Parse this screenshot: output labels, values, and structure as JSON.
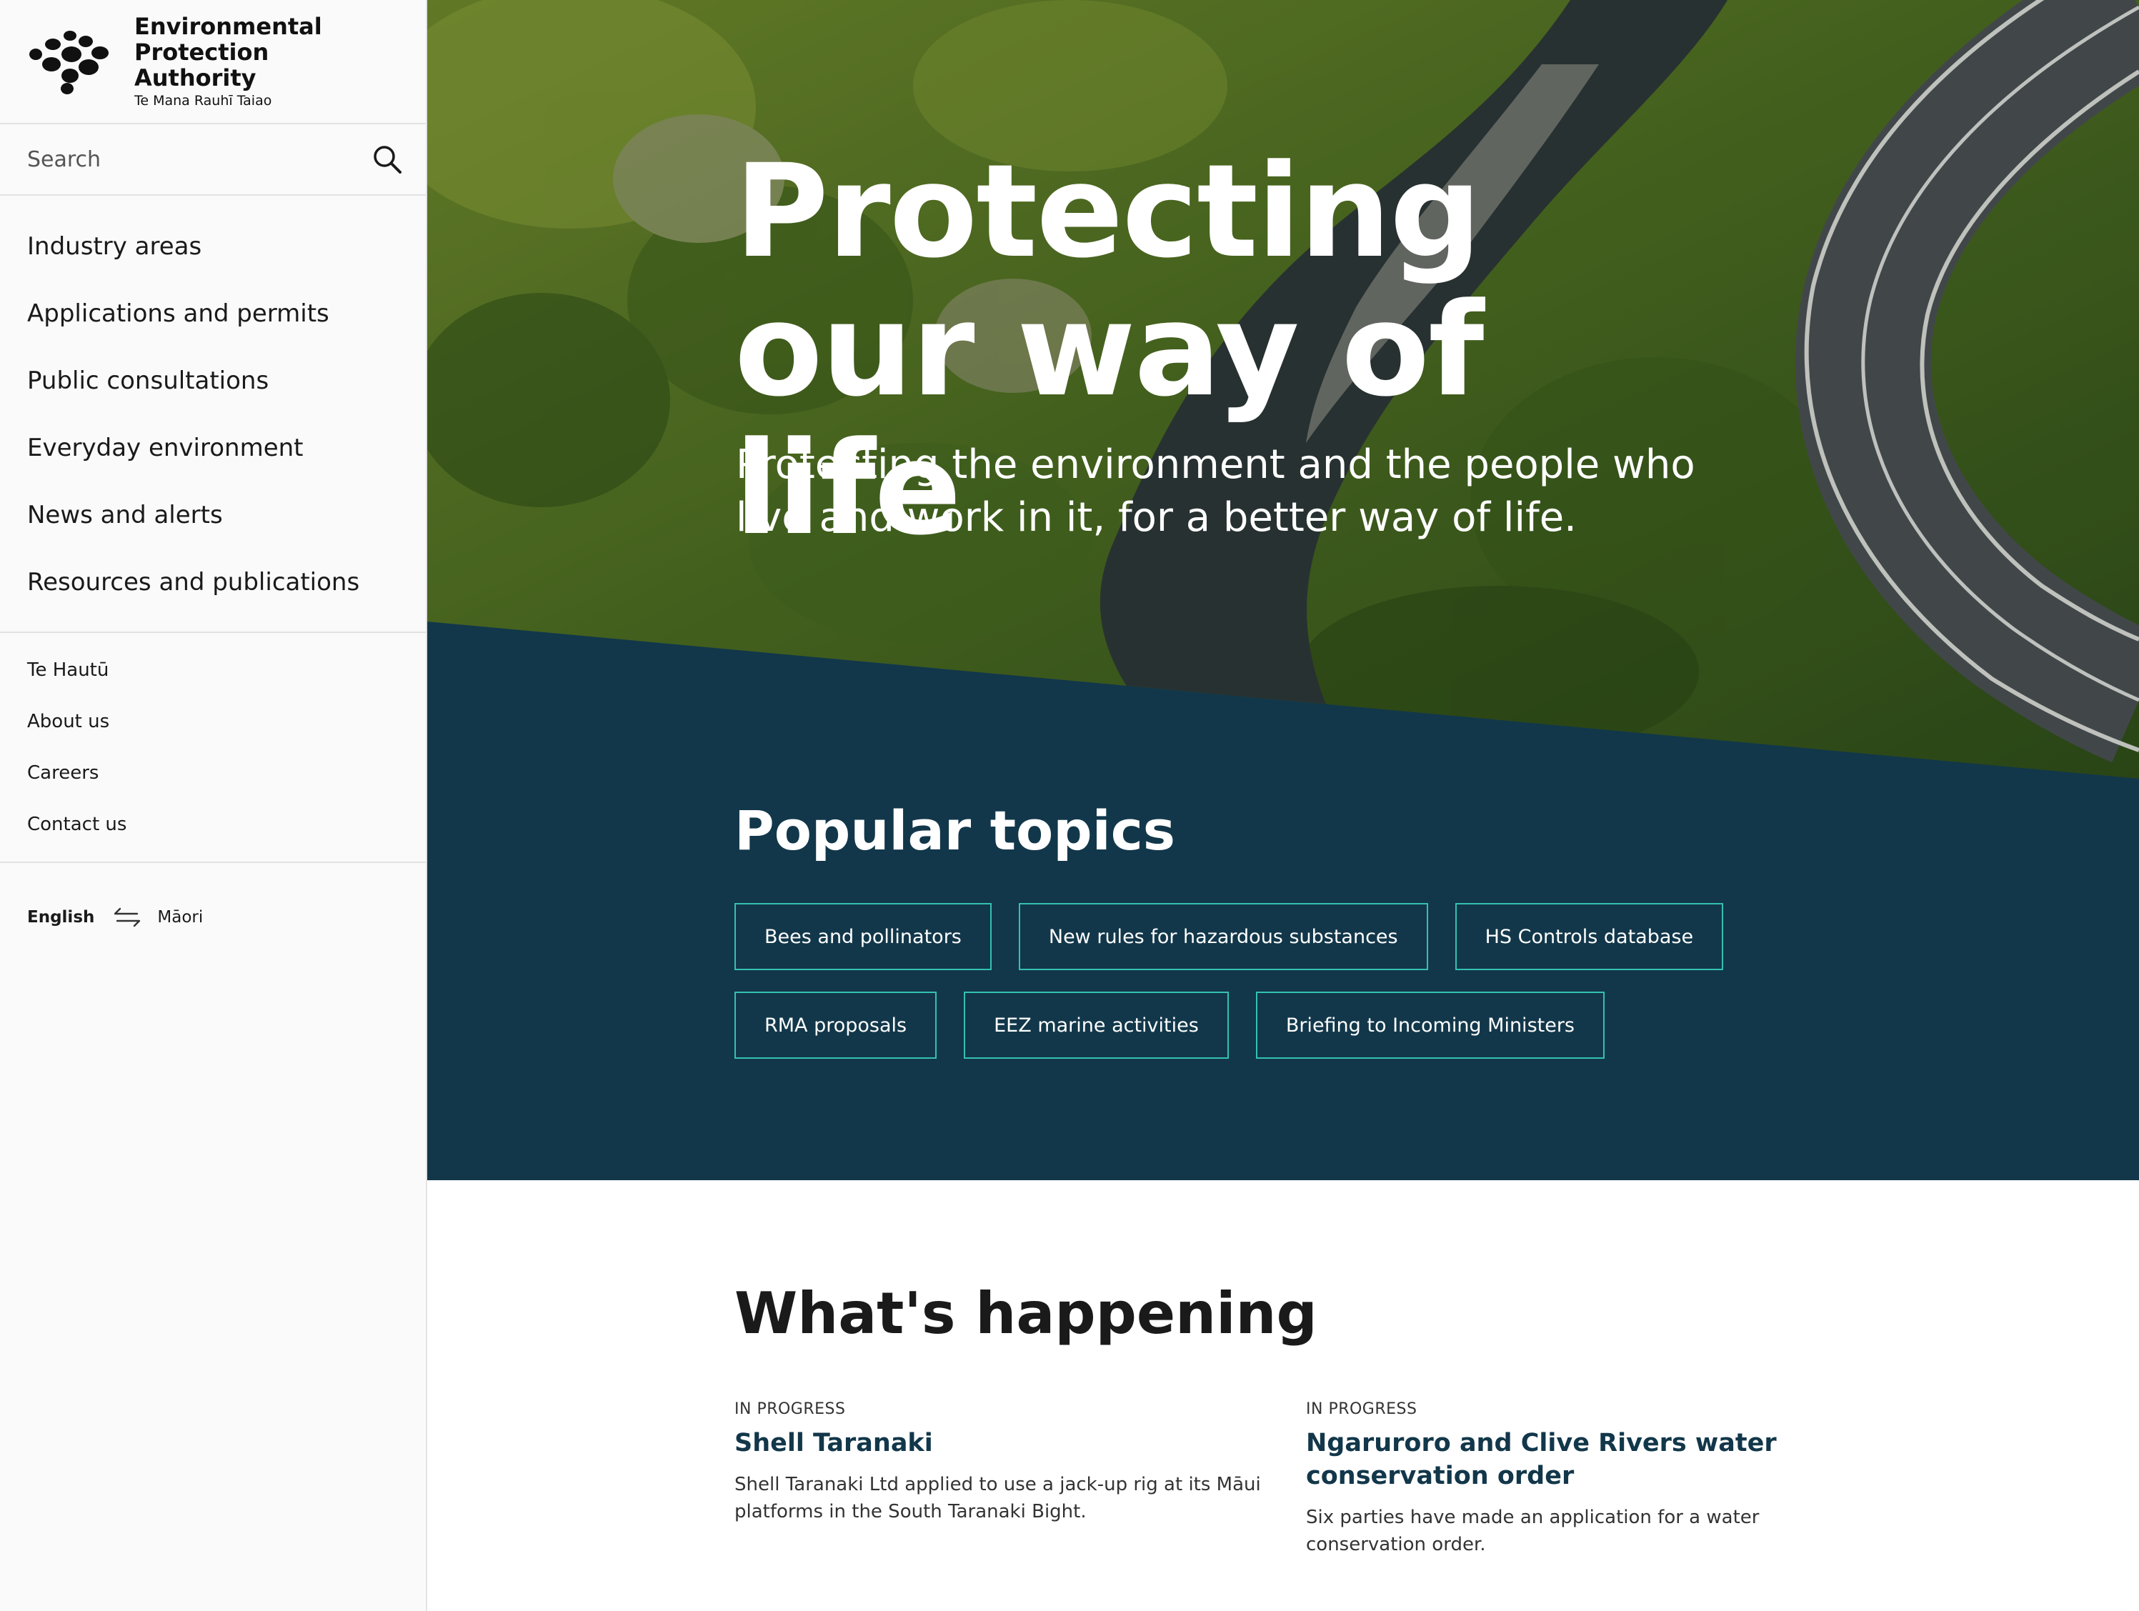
{
  "brand": {
    "name": "Environmental Protection Authority",
    "sub": "Te Mana Rauhī Taiao"
  },
  "search": {
    "placeholder": "Search"
  },
  "nav": {
    "main": [
      "Industry areas",
      "Applications and permits",
      "Public consultations",
      "Everyday environment",
      "News and alerts",
      "Resources and publications"
    ],
    "secondary": [
      "Te Hautū",
      "About us",
      "Careers",
      "Contact us"
    ]
  },
  "language": {
    "current": "English",
    "other": "Māori"
  },
  "hero": {
    "title": "Protecting our way of life",
    "subtitle": "Protecting the environment and the people who live and work in it, for a better way of life."
  },
  "popular": {
    "title": "Popular topics",
    "rows": [
      [
        "Bees and pollinators",
        "New rules for hazardous substances",
        "HS Controls database"
      ],
      [
        "RMA proposals",
        "EEZ marine activities",
        "Briefing to Incoming Ministers"
      ]
    ]
  },
  "happening": {
    "title": "What's happening",
    "items": [
      {
        "status": "IN PROGRESS",
        "title": "Shell Taranaki",
        "desc": "Shell Taranaki Ltd applied to use a jack-up rig at its Māui platforms in the South Taranaki Bight."
      },
      {
        "status": "IN PROGRESS",
        "title": "Ngaruroro and Clive Rivers water conservation order",
        "desc": "Six parties have made an application for a water conservation order."
      }
    ]
  },
  "colors": {
    "navy": "#12374a",
    "teal_outline": "#35c0b4",
    "sidebar_bg": "#fafafa",
    "card_title": "#12374a"
  },
  "icons": {
    "logo": "epa-logo-dots",
    "search": "search-icon",
    "language_swap": "swap-arrows-icon"
  }
}
